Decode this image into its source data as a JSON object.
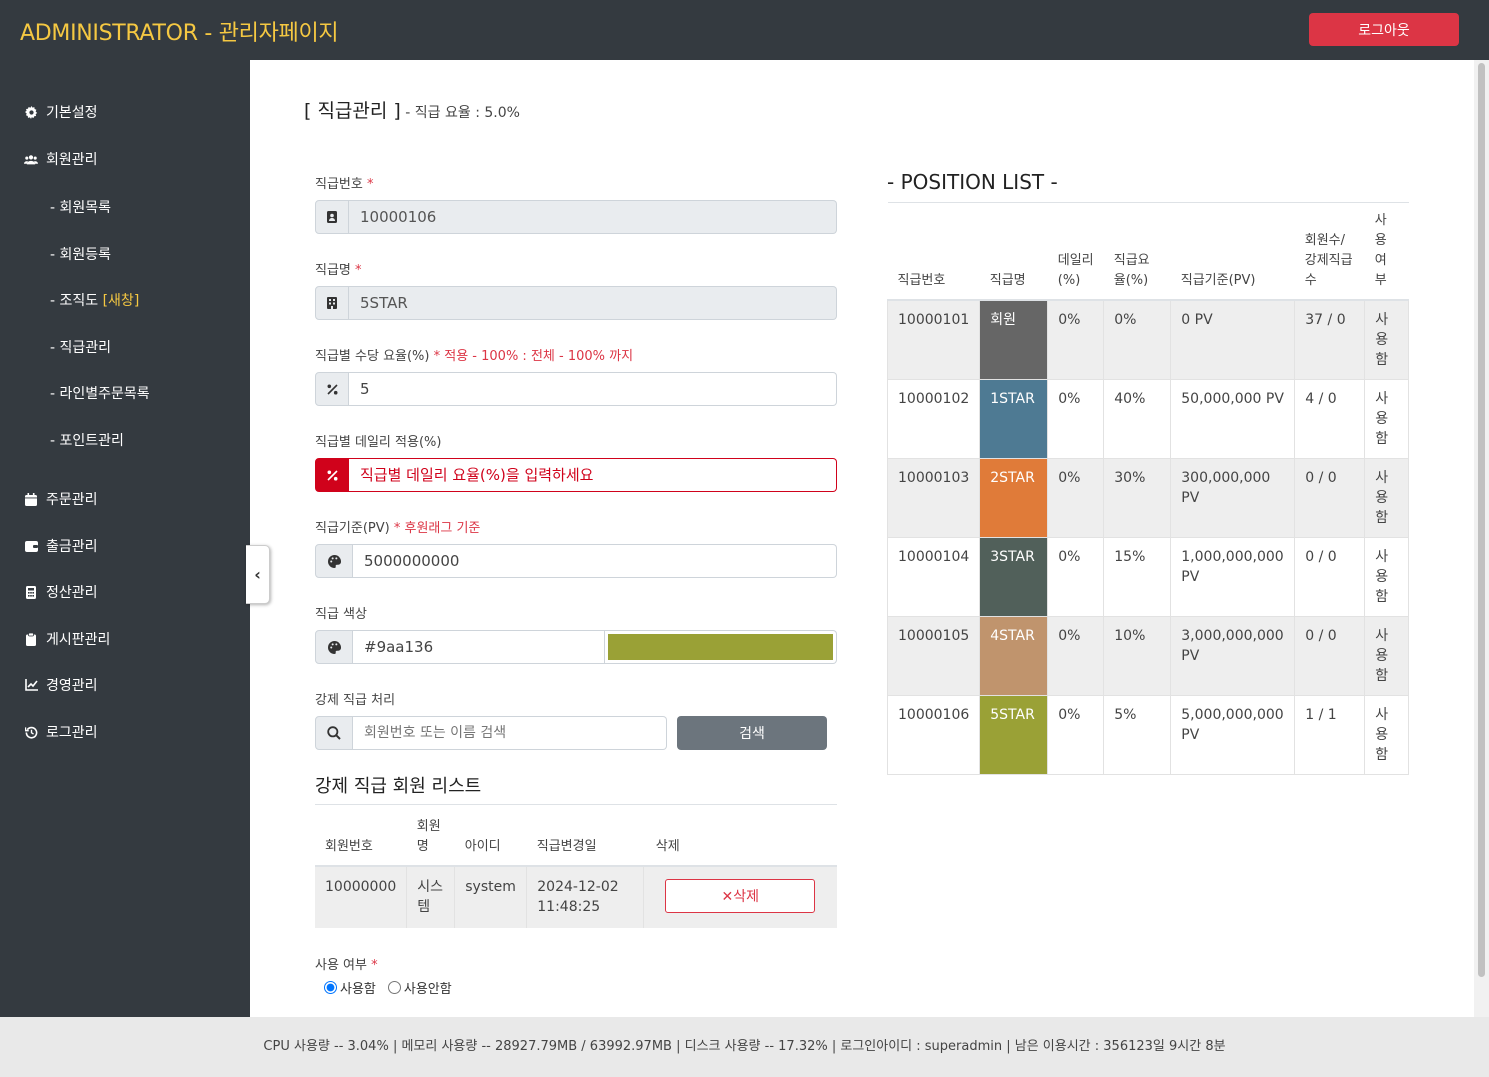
{
  "header": {
    "brand": "ADMINISTRATOR - 관리자페이지",
    "logout_label": "로그아웃"
  },
  "sidebar": {
    "items": [
      {
        "label": "기본설정",
        "icon": "gear-icon"
      },
      {
        "label": "회원관리",
        "icon": "users-icon"
      },
      {
        "label": "주문관리",
        "icon": "calendar-icon"
      },
      {
        "label": "출금관리",
        "icon": "wallet-icon"
      },
      {
        "label": "정산관리",
        "icon": "calculator-icon"
      },
      {
        "label": "게시판관리",
        "icon": "clipboard-icon"
      },
      {
        "label": "경영관리",
        "icon": "line-chart-icon"
      },
      {
        "label": "로그관리",
        "icon": "history-icon"
      }
    ],
    "sub_items": [
      {
        "label": "- 회원목록"
      },
      {
        "label": "- 회원등록"
      },
      {
        "label": "- 조직도 ",
        "badge": "[새창]"
      },
      {
        "label": "- 직급관리"
      },
      {
        "label": "- 라인별주문목록"
      },
      {
        "label": "- 포인트관리"
      }
    ],
    "collapse_glyph": "‹"
  },
  "page": {
    "title": "[ 직급관리 ]",
    "subtitle": " - 직급 요율 : 5.0%"
  },
  "form": {
    "position_no": {
      "label": "직급번호",
      "required": " *",
      "value": "10000106"
    },
    "position_name": {
      "label": "직급명",
      "required": " *",
      "value": "5STAR"
    },
    "commission_rate": {
      "label": "직급별 수당 요율(%)",
      "required": " *",
      "hint": " 적용 - 100% : 전체 - 100% 까지",
      "value": "5"
    },
    "daily_rate": {
      "label": "직급별 데일리 적용(%)",
      "placeholder": "직급별 데일리 요율(%)을 입력하세요"
    },
    "pv_criteria": {
      "label": "직급기준(PV)",
      "required": " *",
      "hint": " 후원래그 기준",
      "value": "5000000000"
    },
    "color": {
      "label": "직급 색상",
      "value": "#9aa136",
      "swatch": "#9aa136"
    },
    "force_position": {
      "label": "강제 직급 처리",
      "placeholder": "회원번호 또는 이름 검색",
      "search_label": "검색"
    },
    "use": {
      "label": "사용 여부",
      "required": " *",
      "options": [
        "사용함",
        "사용안함"
      ],
      "selected": "사용함"
    }
  },
  "forced_members": {
    "title": "강제 직급 회원 리스트",
    "headers": [
      "회원번호",
      "회원명",
      "아이디",
      "직급변경일",
      "삭제"
    ],
    "rows": [
      {
        "member_no": "10000000",
        "name": "시스템",
        "id": "system",
        "changed": "2024-12-02 11:48:25",
        "delete_label": "삭제",
        "delete_glyph": "✕"
      }
    ]
  },
  "position_list": {
    "title": "- POSITION LIST -",
    "headers": [
      "직급번호",
      "직급명",
      "데일리(%)",
      "직급요율(%)",
      "직급기준(PV)",
      "회원수/강제직급수",
      "사용여부"
    ],
    "rows": [
      {
        "no": "10000101",
        "name": "회원",
        "color": "#666666",
        "daily": "0%",
        "rate": "0%",
        "pv": "0 PV",
        "count": "37 / 0",
        "use": "사용함"
      },
      {
        "no": "10000102",
        "name": "1STAR",
        "color": "#4e7a93",
        "daily": "0%",
        "rate": "40%",
        "pv": "50,000,000 PV",
        "count": "4 / 0",
        "use": "사용함"
      },
      {
        "no": "10000103",
        "name": "2STAR",
        "color": "#e07b39",
        "daily": "0%",
        "rate": "30%",
        "pv": "300,000,000 PV",
        "count": "0 / 0",
        "use": "사용함"
      },
      {
        "no": "10000104",
        "name": "3STAR",
        "color": "#51605a",
        "daily": "0%",
        "rate": "15%",
        "pv": "1,000,000,000 PV",
        "count": "0 / 0",
        "use": "사용함"
      },
      {
        "no": "10000105",
        "name": "4STAR",
        "color": "#c0946d",
        "daily": "0%",
        "rate": "10%",
        "pv": "3,000,000,000 PV",
        "count": "0 / 0",
        "use": "사용함"
      },
      {
        "no": "10000106",
        "name": "5STAR",
        "color": "#9aa136",
        "daily": "0%",
        "rate": "5%",
        "pv": "5,000,000,000 PV",
        "count": "1 / 1",
        "use": "사용함"
      }
    ]
  },
  "footer": {
    "status": "CPU 사용량 -- 3.04% | 메모리 사용량 -- 28927.79MB / 63992.97MB | 디스크 사용량 -- 17.32%  |  로그인아이디 : superadmin  |  남은 이용시간 : 356123일 9시간 8분"
  }
}
